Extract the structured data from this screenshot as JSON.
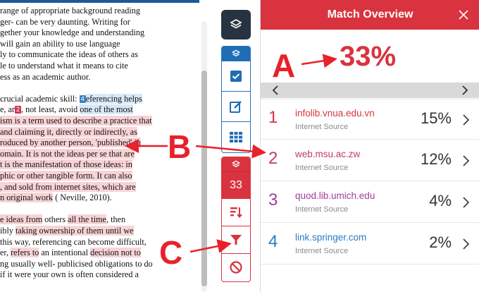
{
  "document": {
    "lines": [
      {
        "parts": [
          {
            "t": "range of appropriate background reading"
          }
        ]
      },
      {
        "parts": [
          {
            "t": "ger- can be very daunting. Writing for"
          }
        ]
      },
      {
        "parts": [
          {
            "t": "gether your knowledge and understanding"
          }
        ]
      },
      {
        "parts": [
          {
            "t": "will gain an ability to use language"
          }
        ]
      },
      {
        "parts": [
          {
            "t": "ly to communicate the ideas of others as"
          }
        ]
      },
      {
        "parts": [
          {
            "t": "le to understand what it means to cite"
          }
        ]
      },
      {
        "parts": [
          {
            "t": "ess as an academic author."
          }
        ]
      },
      {
        "parts": [
          {
            "t": ""
          }
        ]
      },
      {
        "parts": [
          {
            "t": "crucial academic skill: "
          },
          {
            "tag": "4",
            "c": "blue"
          },
          {
            "t": "eferencing helps",
            "h": "b"
          }
        ]
      },
      {
        "parts": [
          {
            "t": "e, ar"
          },
          {
            "tag": "2",
            "c": "red"
          },
          {
            "t": ", not least, avoid "
          },
          {
            "t": "one of the most",
            "h": "b"
          }
        ]
      },
      {
        "parts": [
          {
            "t": "ism is a term used to describe a practice that",
            "h": "r"
          }
        ]
      },
      {
        "parts": [
          {
            "t": " and claiming it, directly or indirectly, as",
            "h": "r"
          }
        ]
      },
      {
        "parts": [
          {
            "t": "roduced by another person, 'published' in",
            "h": "r"
          }
        ]
      },
      {
        "parts": [
          {
            "t": "omain. It is not the ideas per se that are",
            "h": "r"
          }
        ]
      },
      {
        "parts": [
          {
            "t": "t is the manifestation of those ideas: in",
            "h": "r"
          }
        ]
      },
      {
        "parts": [
          {
            "t": "phic or other tangible form. It can also",
            "h": "r"
          }
        ]
      },
      {
        "parts": [
          {
            "t": ", and sold from internet sites, which are",
            "h": "r"
          }
        ]
      },
      {
        "parts": [
          {
            "t": "n original work",
            "h": "r"
          },
          {
            "t": " ( Neville, 2010)."
          }
        ]
      },
      {
        "parts": [
          {
            "t": ""
          }
        ]
      },
      {
        "parts": [
          {
            "t": "e ideas from",
            "h": "r"
          },
          {
            "t": " others "
          },
          {
            "t": "all the time",
            "h": "r"
          },
          {
            "t": ", then"
          }
        ]
      },
      {
        "parts": [
          {
            "t": "ibly "
          },
          {
            "t": "taking ownership of them until we",
            "h": "r"
          }
        ]
      },
      {
        "parts": [
          {
            "t": "this way, referencing can become difficult,"
          }
        ]
      },
      {
        "parts": [
          {
            "t": "er, "
          },
          {
            "t": "refers to",
            "h": "r"
          },
          {
            "t": " an intentional "
          },
          {
            "t": "decision not to",
            "h": "r"
          }
        ]
      },
      {
        "parts": [
          {
            "t": "ng usually well- publicised obligations to do"
          }
        ]
      },
      {
        "parts": [
          {
            "t": "if it were your own is often considered a"
          }
        ]
      }
    ]
  },
  "toolbar": {
    "layers_icon": "layers-icon",
    "blue_group": {
      "header_icon": "layers-icon",
      "buttons": [
        "checkbox-icon",
        "edit-icon",
        "grid-icon"
      ]
    },
    "red_group": {
      "header_icon": "layers-icon",
      "match_count": "33",
      "buttons": [
        "sort-icon",
        "filter-icon",
        "exclude-icon"
      ]
    }
  },
  "panel": {
    "title": "Match Overview",
    "close_icon": "close-icon",
    "overall_percent": "33%",
    "pager_prev": "chevron-left-icon",
    "pager_next": "chevron-right-icon",
    "matches": [
      {
        "num": "1",
        "source": "infolib.vnua.edu.vn",
        "type": "Internet Source",
        "percent": "15%",
        "color": "#d9333f"
      },
      {
        "num": "2",
        "source": "web.msu.ac.zw",
        "type": "Internet Source",
        "percent": "12%",
        "color": "#c2386e"
      },
      {
        "num": "3",
        "source": "quod.lib.umich.edu",
        "type": "Internet Source",
        "percent": "4%",
        "color": "#a03c9c"
      },
      {
        "num": "4",
        "source": "link.springer.com",
        "type": "Internet Source",
        "percent": "2%",
        "color": "#2a7cc2"
      }
    ]
  },
  "annotations": {
    "a": "A",
    "b": "B",
    "c": "C",
    "color": "#e8212b"
  }
}
